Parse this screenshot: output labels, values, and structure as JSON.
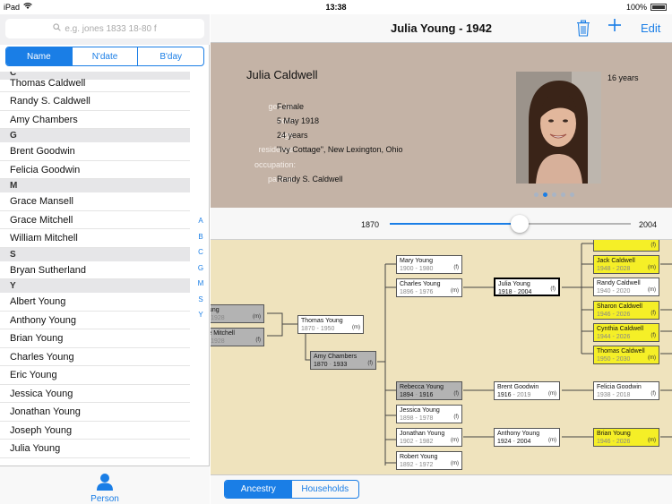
{
  "status": {
    "device": "iPad",
    "time": "13:38",
    "battery": "100%"
  },
  "search": {
    "placeholder": "e.g. jones 1833 18-80 f"
  },
  "sort_tabs": [
    "Name",
    "N'date",
    "B'day"
  ],
  "list_sections": [
    {
      "letter": "C",
      "names": [
        "Thomas Caldwell",
        "Randy S. Caldwell",
        "Amy Chambers"
      ]
    },
    {
      "letter": "G",
      "names": [
        "Brent Goodwin",
        "Felicia Goodwin"
      ]
    },
    {
      "letter": "M",
      "names": [
        "Grace Mansell",
        "Grace Mitchell",
        "William Mitchell"
      ]
    },
    {
      "letter": "S",
      "names": [
        "Bryan Sutherland"
      ]
    },
    {
      "letter": "Y",
      "names": [
        "Albert Young",
        "Anthony Young",
        "Brian Young",
        "Charles Young",
        "Eric Young",
        "Jessica Young",
        "Jonathan Young",
        "Joseph Young",
        "Julia Young"
      ]
    }
  ],
  "index_letters": [
    "A",
    "B",
    "C",
    "G",
    "M",
    "S",
    "Y"
  ],
  "tabbar": {
    "person_label": "Person"
  },
  "nav": {
    "title": "Julia Young - 1942",
    "edit_label": "Edit"
  },
  "person": {
    "name": "Julia Caldwell",
    "photo_age": "16 years",
    "fields": [
      {
        "label": "gender:",
        "value": "Female"
      },
      {
        "label": "born:",
        "value": "5 May 1918"
      },
      {
        "label": "age:",
        "value": "24 years"
      },
      {
        "label": "residence:",
        "value": "\"Ivy Cottage\", New Lexington, Ohio"
      },
      {
        "label": "occupation:",
        "value": ""
      },
      {
        "label": "partner:",
        "value": "Randy S. Caldwell"
      }
    ],
    "photo_pages": 5,
    "photo_page_current": 2
  },
  "timeline": {
    "min": "1870",
    "max": "2004",
    "min_year": 1870,
    "max_year": 2004,
    "current_year": 1942
  },
  "tree": {
    "boxes": [
      {
        "name": "Young",
        "born": "",
        "died": "8 - 1928",
        "sex": "(m)",
        "style": "grey"
      },
      {
        "name": "ace Mitchell",
        "born": "",
        "died": "8 - 1928",
        "sex": "(f)",
        "style": "grey"
      },
      {
        "name": "Thomas Young",
        "born": "1870",
        "died": "1950",
        "sex": "(m)",
        "style": "white"
      },
      {
        "name": "Amy Chambers",
        "born": "1870",
        "died": "1933",
        "sex": "(f)",
        "style": "grey"
      },
      {
        "name": "Mary Young",
        "born": "1900",
        "died": "1980",
        "sex": "(f)",
        "style": "white"
      },
      {
        "name": "Charles Young",
        "born": "1896",
        "died": "1976",
        "sex": "(m)",
        "style": "white"
      },
      {
        "name": "Rebecca Young",
        "born": "1894",
        "died": "1916",
        "sex": "(f)",
        "style": "grey"
      },
      {
        "name": "Jessica Young",
        "born": "1898",
        "died": "1978",
        "sex": "(f)",
        "style": "white"
      },
      {
        "name": "Jonathan Young",
        "born": "1902",
        "died": "1982",
        "sex": "(m)",
        "style": "white"
      },
      {
        "name": "Robert Young",
        "born": "1892",
        "died": "1972",
        "sex": "(m)",
        "style": "white"
      },
      {
        "name": "Julia Young",
        "born": "1918",
        "died": "2004",
        "sex": "(f)",
        "style": "selected"
      },
      {
        "name": "Brent Goodwin",
        "born": "1916",
        "died": "2019",
        "sex": "(m)",
        "style": "white"
      },
      {
        "name": "Anthony Young",
        "born": "1924",
        "died": "2004",
        "sex": "(m)",
        "style": "white"
      },
      {
        "name": "",
        "born": "1952",
        "died": "2032",
        "sex": "(f)",
        "style": "yellow"
      },
      {
        "name": "Jack Caldwell",
        "born": "1948",
        "died": "2028",
        "sex": "(m)",
        "style": "yellow"
      },
      {
        "name": "Randy Caldwell",
        "born": "1940",
        "died": "2020",
        "sex": "(m)",
        "style": "white"
      },
      {
        "name": "Sharon Caldwell",
        "born": "1946",
        "died": "2026",
        "sex": "(f)",
        "style": "yellow"
      },
      {
        "name": "Cynthia Caldwell",
        "born": "1944",
        "died": "2026",
        "sex": "(f)",
        "style": "yellow"
      },
      {
        "name": "Thomas Caldwell",
        "born": "1950",
        "died": "2030",
        "sex": "(m)",
        "style": "yellow"
      },
      {
        "name": "Felicia Goodwin",
        "born": "1938",
        "died": "2018",
        "sex": "(f)",
        "style": "white"
      },
      {
        "name": "Brian Young",
        "born": "1946",
        "died": "2026",
        "sex": "(m)",
        "style": "yellow"
      }
    ]
  },
  "view_tabs": [
    "Ancestry",
    "Households"
  ],
  "colors": {
    "accent": "#1a7ee6",
    "detail_bg": "#c4b3a6",
    "tree_bg": "#efe3bd",
    "highlight": "#f5ef27"
  }
}
